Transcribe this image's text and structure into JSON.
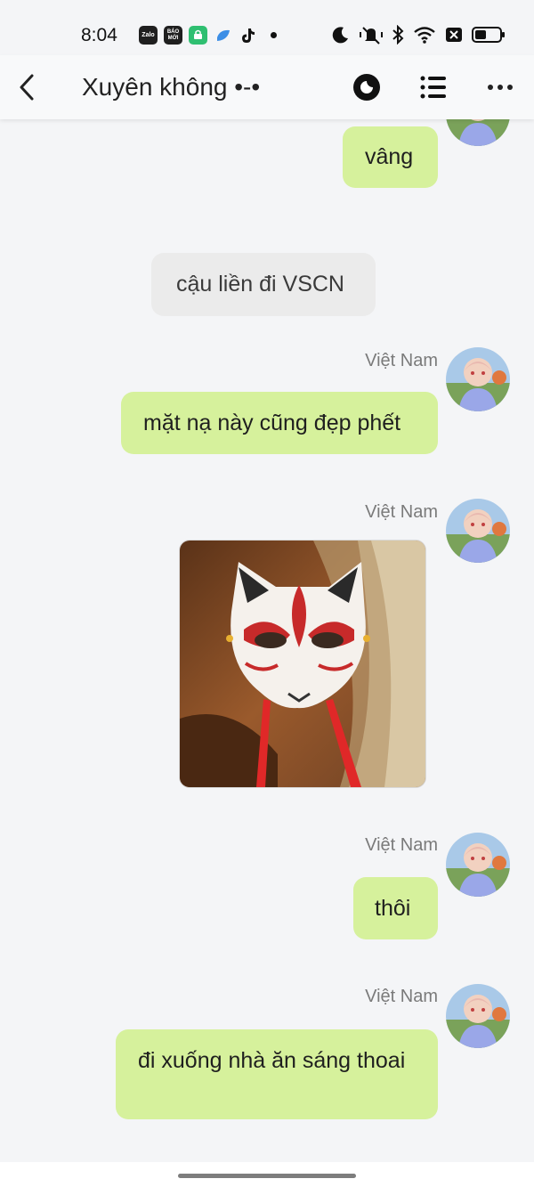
{
  "status_bar": {
    "time": "8:04",
    "app_icons": [
      {
        "name": "zalo-icon",
        "label": "Zalo",
        "color": "#1f1f1f"
      },
      {
        "name": "baomoi-icon",
        "label": "BÁO MỚI",
        "color": "#1f1f1f"
      },
      {
        "name": "green-app-icon",
        "label": "",
        "color": "#2fbf71"
      },
      {
        "name": "blue-app-icon",
        "label": "",
        "color": "#3c8ee6"
      },
      {
        "name": "tiktok-icon",
        "label": "",
        "color": "#111111"
      }
    ]
  },
  "header": {
    "title": "Xuyên không •-•",
    "actions": [
      "back-icon",
      "theme-icon",
      "list-icon",
      "more-icon"
    ]
  },
  "messages": [
    {
      "type": "text",
      "own": true,
      "text": "vâng"
    },
    {
      "type": "system",
      "text": "cậu liền đi VSCN"
    },
    {
      "type": "text",
      "own": true,
      "sender": "Việt Nam",
      "text": "mặt nạ này cũng đẹp phết"
    },
    {
      "type": "image",
      "own": true,
      "sender": "Việt Nam",
      "image": "fox-mask-photo"
    },
    {
      "type": "text",
      "own": true,
      "sender": "Việt Nam",
      "text": "thôi"
    },
    {
      "type": "text",
      "own": true,
      "sender": "Việt Nam",
      "text": "đi xuống nhà ăn sáng thoai"
    }
  ],
  "colors": {
    "own_bubble": "#d6f19c",
    "system_bubble": "#ebebeb",
    "background": "#f4f5f7"
  }
}
